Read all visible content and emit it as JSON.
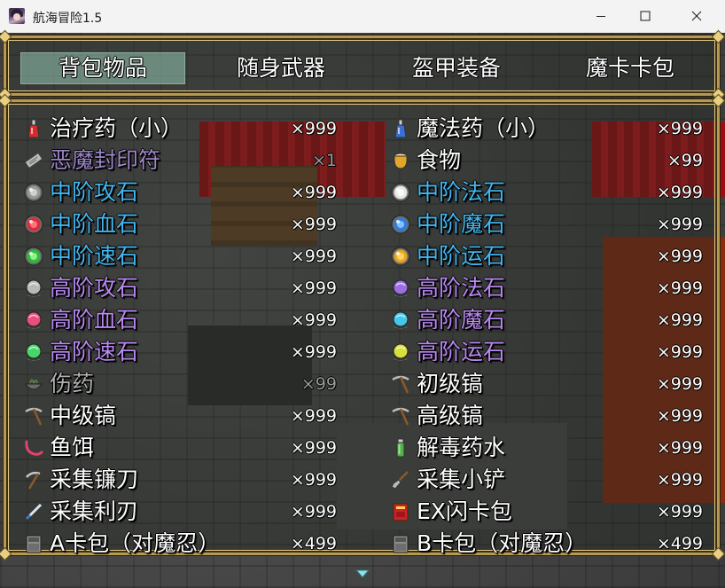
{
  "window": {
    "title": "航海冒险1.5"
  },
  "tabs": [
    {
      "label": "背包物品",
      "selected": true
    },
    {
      "label": "随身武器",
      "selected": false
    },
    {
      "label": "盔甲装备",
      "selected": false
    },
    {
      "label": "魔卡卡包",
      "selected": false
    }
  ],
  "colors": {
    "white": "#ffffff",
    "purple_muted": "#9d86c7",
    "blue": "#44b6ee",
    "violet": "#b989f0",
    "gray": "#b0b0b0",
    "selection": "#96c8b4",
    "frame_gold": "#b79a52"
  },
  "items": [
    {
      "name": "治疗药（小）",
      "qty": "×999",
      "icon": "red-potion-icon",
      "color": "#ffffff"
    },
    {
      "name": "魔法药（小）",
      "qty": "×999",
      "icon": "blue-potion-icon",
      "color": "#ffffff"
    },
    {
      "name": "恶魔封印符",
      "qty": "×1",
      "icon": "scroll-icon",
      "color": "#9d86c7",
      "dim": true
    },
    {
      "name": "食物",
      "qty": "×99",
      "icon": "food-pot-icon",
      "color": "#ffffff"
    },
    {
      "name": "中阶攻石",
      "qty": "×999",
      "icon": "gray-orb-icon",
      "color": "#44b6ee"
    },
    {
      "name": "中阶法石",
      "qty": "×999",
      "icon": "white-orb-icon",
      "color": "#44b6ee"
    },
    {
      "name": "中阶血石",
      "qty": "×999",
      "icon": "red-orb-icon",
      "color": "#44b6ee"
    },
    {
      "name": "中阶魔石",
      "qty": "×999",
      "icon": "blue-orb-icon",
      "color": "#44b6ee"
    },
    {
      "name": "中阶速石",
      "qty": "×999",
      "icon": "green-orb-icon",
      "color": "#44b6ee"
    },
    {
      "name": "中阶运石",
      "qty": "×999",
      "icon": "gold-orb-icon",
      "color": "#44b6ee"
    },
    {
      "name": "高阶攻石",
      "qty": "×999",
      "icon": "gray-crystal-icon",
      "color": "#b989f0"
    },
    {
      "name": "高阶法石",
      "qty": "×999",
      "icon": "purple-crystal-icon",
      "color": "#b989f0"
    },
    {
      "name": "高阶血石",
      "qty": "×999",
      "icon": "pink-crystal-icon",
      "color": "#b989f0"
    },
    {
      "name": "高阶魔石",
      "qty": "×999",
      "icon": "cyan-crystal-icon",
      "color": "#b989f0"
    },
    {
      "name": "高阶速石",
      "qty": "×999",
      "icon": "green-crystal-icon",
      "color": "#b989f0"
    },
    {
      "name": "高阶运石",
      "qty": "×999",
      "icon": "yellow-crystal-icon",
      "color": "#b989f0"
    },
    {
      "name": "伤药",
      "qty": "×99",
      "icon": "herb-bowl-icon",
      "color": "#b0b0b0",
      "dim": true
    },
    {
      "name": "初级镐",
      "qty": "×999",
      "icon": "pickaxe-icon",
      "color": "#ffffff"
    },
    {
      "name": "中级镐",
      "qty": "×999",
      "icon": "pickaxe-icon",
      "color": "#ffffff"
    },
    {
      "name": "高级镐",
      "qty": "×999",
      "icon": "pickaxe-icon",
      "color": "#ffffff"
    },
    {
      "name": "鱼饵",
      "qty": "×999",
      "icon": "worm-bait-icon",
      "color": "#ffffff"
    },
    {
      "name": "解毒药水",
      "qty": "×999",
      "icon": "green-vial-icon",
      "color": "#ffffff"
    },
    {
      "name": "采集镰刀",
      "qty": "×999",
      "icon": "sickle-icon",
      "color": "#ffffff"
    },
    {
      "name": "采集小铲",
      "qty": "×999",
      "icon": "shovel-icon",
      "color": "#ffffff"
    },
    {
      "name": "采集利刃",
      "qty": "×999",
      "icon": "blade-icon",
      "color": "#ffffff"
    },
    {
      "name": "EX闪卡包",
      "qty": "×999",
      "icon": "red-book-icon",
      "color": "#ffffff"
    },
    {
      "name": "A卡包（对魔忍）",
      "qty": "×499",
      "icon": "card-pack-icon",
      "color": "#ffffff"
    },
    {
      "name": "B卡包（对魔忍）",
      "qty": "×499",
      "icon": "card-pack-icon",
      "color": "#ffffff"
    }
  ]
}
